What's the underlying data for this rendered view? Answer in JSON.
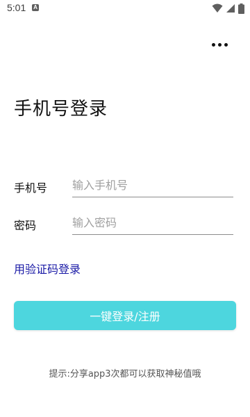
{
  "status_bar": {
    "time": "5:01",
    "notification_badge": "A",
    "icons": [
      "wifi-icon",
      "signal-icon",
      "battery-icon"
    ]
  },
  "header": {
    "more_icon": "more-horizontal-icon"
  },
  "page": {
    "title": "手机号登录"
  },
  "form": {
    "phone": {
      "label": "手机号",
      "placeholder": "输入手机号",
      "value": ""
    },
    "password": {
      "label": "密码",
      "placeholder": "输入密码",
      "value": ""
    }
  },
  "links": {
    "sms_login": "用验证码登录"
  },
  "actions": {
    "login_register": "一键登录/注册"
  },
  "hint": {
    "text": "提示:分享app3次都可以获取神秘值哦"
  },
  "colors": {
    "primary_button": "#4dd6de",
    "link": "#1a1aa6",
    "background": "#ffffff"
  }
}
